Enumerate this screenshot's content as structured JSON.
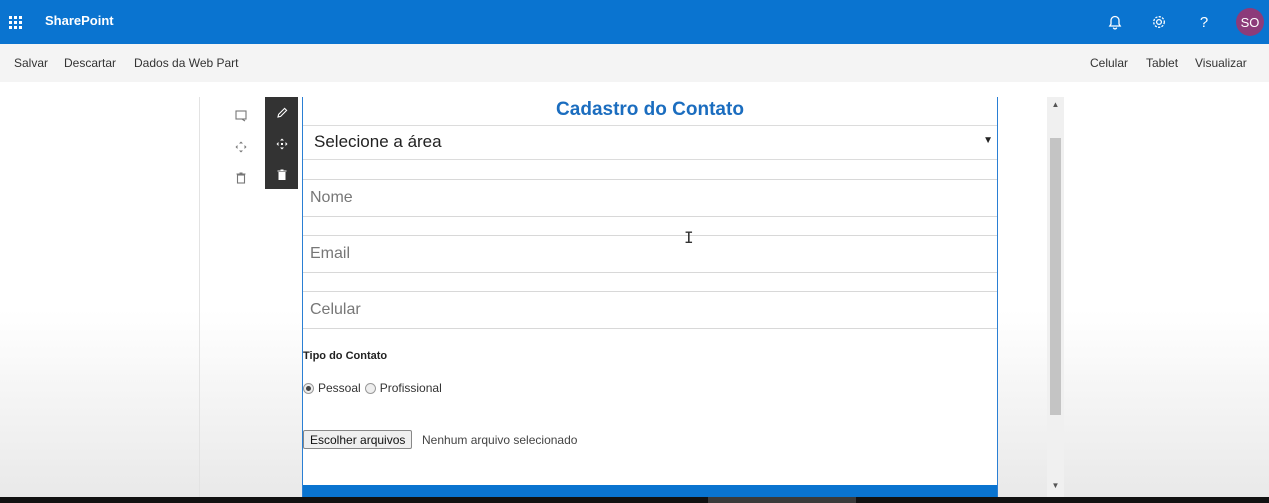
{
  "suitebar": {
    "brand": "SharePoint",
    "avatar_initials": "SO",
    "icons": [
      "app-launcher-icon",
      "bell-icon",
      "gear-icon",
      "help-icon"
    ],
    "help_glyph": "?"
  },
  "commandbar": {
    "left": [
      "Salvar",
      "Descartar",
      "Dados da Web Part"
    ],
    "right": [
      "Celular",
      "Tablet",
      "Visualizar"
    ]
  },
  "webpart": {
    "title": "Cadastro do Contato",
    "area_select": "Selecione a área",
    "fields": {
      "nome_placeholder": "Nome",
      "email_placeholder": "Email",
      "celular_placeholder": "Celular"
    },
    "tipo_label": "Tipo do Contato",
    "radio": {
      "options": [
        "Pessoal",
        "Profissional"
      ],
      "selected": "Pessoal"
    },
    "file": {
      "button": "Escolher arquivos",
      "status": "Nenhum arquivo selecionado"
    }
  },
  "colors": {
    "suitebar": "#0a74d0",
    "title": "#1b6dbf",
    "avatar": "#8c3b7a"
  }
}
